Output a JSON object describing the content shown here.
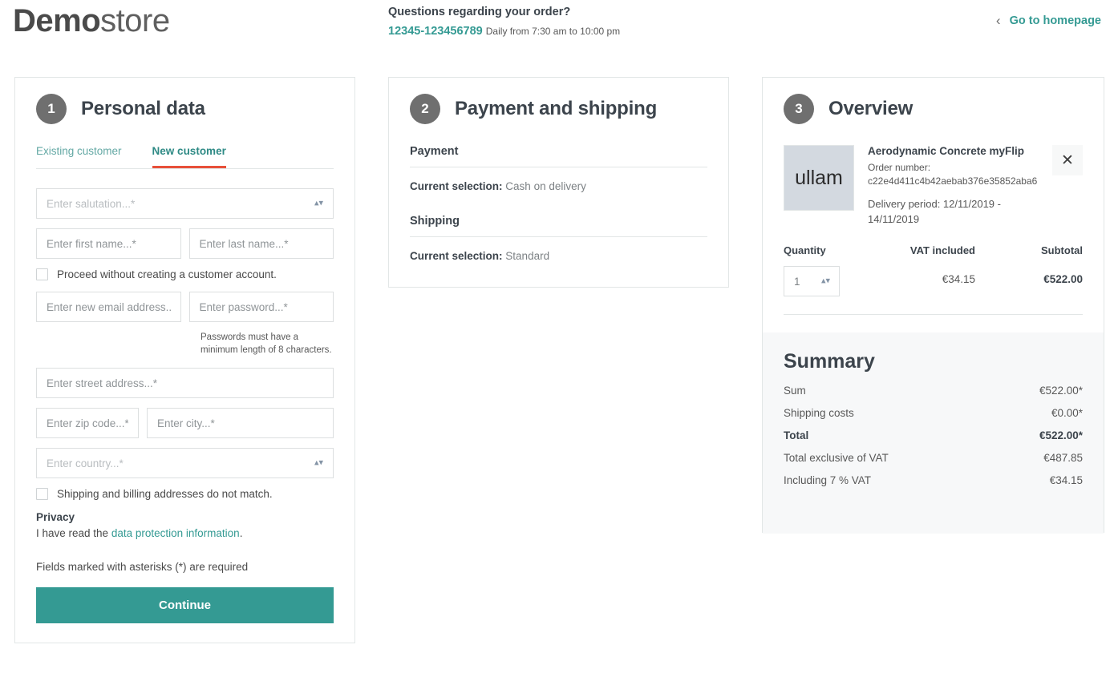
{
  "header": {
    "logo_strong": "Demo",
    "logo_light": "store",
    "contact_question": "Questions regarding your order?",
    "contact_phone": "12345-123456789",
    "contact_hours": "Daily from 7:30 am to 10:00 pm",
    "homepage_chevron": "‹",
    "homepage_label": "Go to homepage",
    "accent_teal": "#349a93"
  },
  "personal": {
    "step": "1",
    "title": "Personal data",
    "tabs": [
      {
        "label": "Existing customer",
        "active": false
      },
      {
        "label": "New customer",
        "active": true
      }
    ],
    "active_tab_underline": "#e8503a",
    "salutation_placeholder": "Enter salutation...*",
    "first_name_placeholder": "Enter first name...*",
    "last_name_placeholder": "Enter last name...*",
    "no_account_label": "Proceed without creating a customer account.",
    "email_placeholder": "Enter new email address...*",
    "password_placeholder": "Enter password...*",
    "password_hint": "Passwords must have a minimum length of 8 characters.",
    "street_placeholder": "Enter street address...*",
    "zip_placeholder": "Enter zip code...*",
    "city_placeholder": "Enter city...*",
    "country_placeholder": "Enter country...*",
    "address_mismatch_label": "Shipping and billing addresses do not match.",
    "privacy_title": "Privacy",
    "privacy_prefix": "I have read the ",
    "privacy_link": "data protection information",
    "privacy_suffix": ".",
    "required_note": "Fields marked with asterisks (*) are required",
    "continue_label": "Continue",
    "select_arrows": "▴▾"
  },
  "payment": {
    "step": "2",
    "title": "Payment and shipping",
    "payment_section": "Payment",
    "payment_selection_label": "Current selection:",
    "payment_selection_value": "Cash on delivery",
    "shipping_section": "Shipping",
    "shipping_selection_label": "Current selection:",
    "shipping_selection_value": "Standard"
  },
  "overview": {
    "step": "3",
    "title": "Overview",
    "product": {
      "thumb_text": "ullam",
      "name": "Aerodynamic Concrete myFlip",
      "order_number_label": "Order number:",
      "order_number": "c22e4d411c4b42aebab376e35852aba6",
      "delivery_period": "Delivery period: 12/11/2019 - 14/11/2019",
      "remove_icon": "✕"
    },
    "quantity_header": "Quantity",
    "vat_header": "VAT included",
    "subtotal_header": "Subtotal",
    "quantity_value": "1",
    "quantity_arrows": "▴▾",
    "vat_value": "€34.15",
    "subtotal_value": "€522.00",
    "summary_title": "Summary",
    "summary_rows": [
      {
        "label": "Sum",
        "value": "€522.00*",
        "bold": false
      },
      {
        "label": "Shipping costs",
        "value": "€0.00*",
        "bold": false
      },
      {
        "label": "Total",
        "value": "€522.00*",
        "bold": true
      },
      {
        "label": "Total exclusive of VAT",
        "value": "€487.85",
        "bold": false
      },
      {
        "label": "Including 7 % VAT",
        "value": "€34.15",
        "bold": false
      }
    ]
  }
}
